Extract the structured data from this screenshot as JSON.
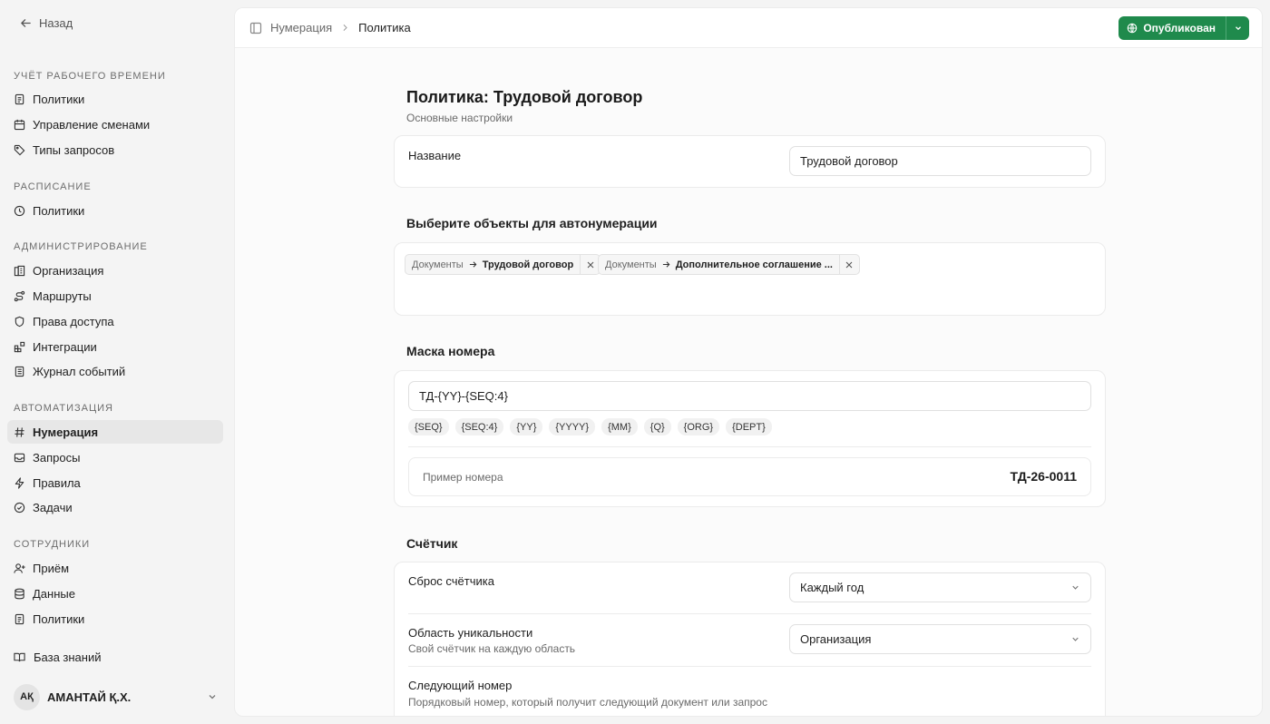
{
  "sidebar": {
    "back_label": "Назад",
    "sections": [
      {
        "title": "Учёт рабочего времени",
        "items": [
          {
            "label": "Политики",
            "icon": "file-icon"
          },
          {
            "label": "Управление сменами",
            "icon": "calendar-icon"
          },
          {
            "label": "Типы запросов",
            "icon": "tag-icon"
          }
        ]
      },
      {
        "title": "Расписание",
        "items": [
          {
            "label": "Политики",
            "icon": "clock-icon"
          }
        ]
      },
      {
        "title": "Администрирование",
        "items": [
          {
            "label": "Организация",
            "icon": "building-icon"
          },
          {
            "label": "Маршруты",
            "icon": "route-icon"
          },
          {
            "label": "Права доступа",
            "icon": "shield-icon"
          },
          {
            "label": "Интеграции",
            "icon": "blocks-icon"
          },
          {
            "label": "Журнал событий",
            "icon": "log-icon"
          }
        ]
      },
      {
        "title": "Автоматизация",
        "items": [
          {
            "label": "Нумерация",
            "icon": "hash-icon",
            "active": true
          },
          {
            "label": "Запросы",
            "icon": "inbox-icon"
          },
          {
            "label": "Правила",
            "icon": "zap-icon"
          },
          {
            "label": "Задачи",
            "icon": "check-circle-icon"
          }
        ]
      },
      {
        "title": "Сотрудники",
        "items": [
          {
            "label": "Приём",
            "icon": "user-plus-icon"
          },
          {
            "label": "Данные",
            "icon": "database-icon"
          },
          {
            "label": "Политики",
            "icon": "file-icon"
          }
        ]
      }
    ],
    "knowledge_base": "База знаний",
    "user": {
      "initials": "АҚ",
      "name": "АМАНТАЙ Қ.Х."
    }
  },
  "header": {
    "breadcrumb": [
      "Нумерация",
      "Политика"
    ],
    "publish_label": "Опубликован"
  },
  "page": {
    "title": "Политика: Трудовой договор",
    "subtitle": "Основные настройки"
  },
  "name_card": {
    "label": "Название",
    "value": "Трудовой договор"
  },
  "objects": {
    "title": "Выберите объекты для автонумерации",
    "tags": [
      {
        "path": "Документы",
        "name": "Трудовой договор"
      },
      {
        "path": "Документы",
        "name": "Дополнительное соглашение ..."
      }
    ]
  },
  "mask": {
    "title": "Маска номера",
    "value": "ТД-{YY}-{SEQ:4}",
    "tokens": [
      "{SEQ}",
      "{SEQ:4}",
      "{YY}",
      "{YYYY}",
      "{MM}",
      "{Q}",
      "{ORG}",
      "{DEPT}"
    ],
    "example_label": "Пример номера",
    "example_value": "ТД-26-0011"
  },
  "counter": {
    "title": "Счётчик",
    "reset_label": "Сброс счётчика",
    "reset_value": "Каждый год",
    "scope_label": "Область уникальности",
    "scope_hint": "Свой счётчик на каждую область",
    "scope_value": "Организация",
    "next_label": "Следующий номер",
    "next_hint": "Порядковый номер, который получит следующий документ или запрос"
  }
}
